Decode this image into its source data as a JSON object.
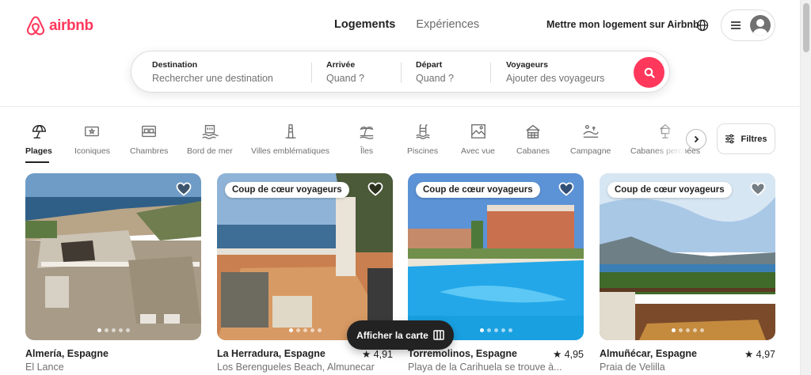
{
  "brand": {
    "name": "airbnb",
    "color": "#ff385c"
  },
  "nav": {
    "tabs": [
      {
        "label": "Logements",
        "active": true
      },
      {
        "label": "Expériences",
        "active": false
      }
    ],
    "host_link": "Mettre mon logement sur Airbnb",
    "globe_icon": "globe-icon",
    "menu_icon": "hamburger-icon"
  },
  "search": {
    "destination": {
      "label": "Destination",
      "placeholder": "Rechercher une destination"
    },
    "checkin": {
      "label": "Arrivée",
      "placeholder": "Quand ?"
    },
    "checkout": {
      "label": "Départ",
      "placeholder": "Quand ?"
    },
    "guests": {
      "label": "Voyageurs",
      "placeholder": "Ajouter des voyageurs"
    }
  },
  "categories": [
    {
      "label": "Plages",
      "icon": "beach-umbrella-icon",
      "active": true
    },
    {
      "label": "Iconiques",
      "icon": "ticket-icon",
      "active": false
    },
    {
      "label": "Chambres",
      "icon": "bed-icon",
      "active": false
    },
    {
      "label": "Bord de mer",
      "icon": "seaside-icon",
      "active": false
    },
    {
      "label": "Villes emblématiques",
      "icon": "tower-icon",
      "active": false
    },
    {
      "label": "Îles",
      "icon": "palm-island-icon",
      "active": false
    },
    {
      "label": "Piscines",
      "icon": "pool-icon",
      "active": false
    },
    {
      "label": "Avec vue",
      "icon": "view-icon",
      "active": false
    },
    {
      "label": "Cabanes",
      "icon": "cabin-icon",
      "active": false
    },
    {
      "label": "Campagne",
      "icon": "countryside-icon",
      "active": false
    },
    {
      "label": "Cabanes perchées",
      "icon": "treehouse-icon",
      "active": false
    }
  ],
  "filters_label": "Filtres",
  "listings": [
    {
      "title": "Almería, Espagne",
      "subtitle": "El Lance",
      "rating": "",
      "badge": "",
      "photo_dots": 5
    },
    {
      "title": "La Herradura, Espagne",
      "subtitle": "Los Berengueles Beach, Almunecar",
      "rating": "★ 4,91",
      "badge": "Coup de cœur voyageurs",
      "photo_dots": 5
    },
    {
      "title": "Torremolinos, Espagne",
      "subtitle": "Playa de la Carihuela se trouve à...",
      "rating": "★ 4,95",
      "badge": "Coup de cœur voyageurs",
      "photo_dots": 5
    },
    {
      "title": "Almuñécar, Espagne",
      "subtitle": "Praia de Velilla",
      "rating": "★ 4,97",
      "badge": "Coup de cœur voyageurs",
      "photo_dots": 5
    }
  ],
  "map_button": "Afficher la carte"
}
